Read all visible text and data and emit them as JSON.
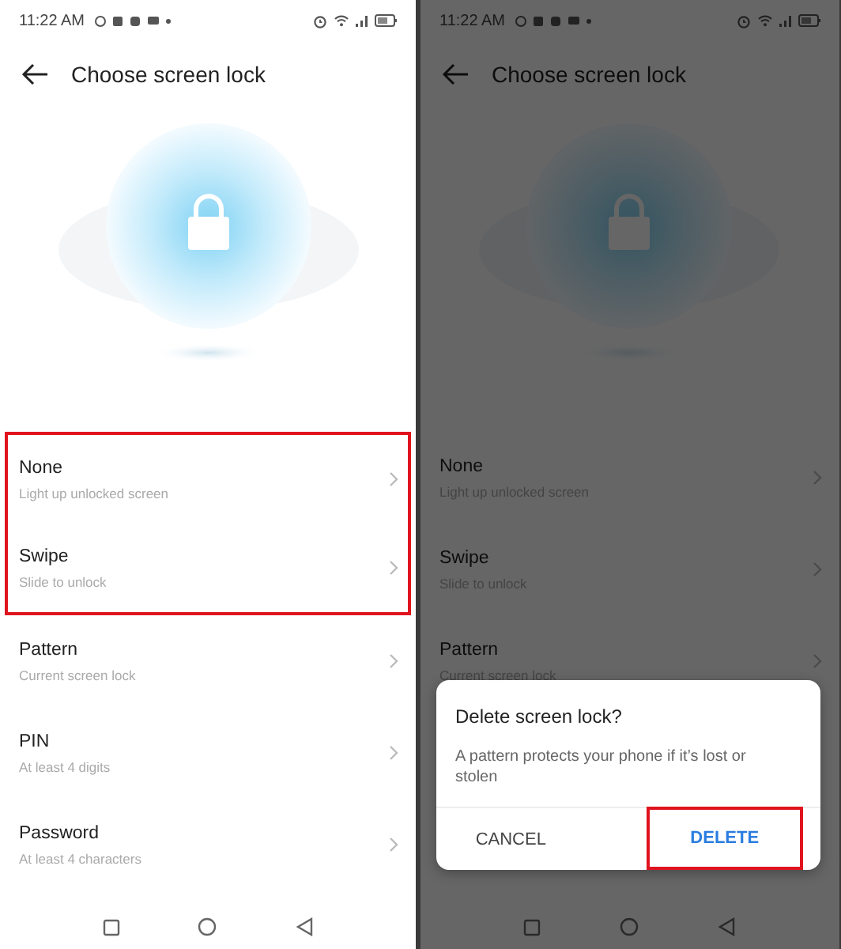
{
  "screens": [
    {
      "status_bar": {
        "time": "11:22 AM"
      },
      "title": "Choose screen lock",
      "dimmed": false,
      "options": [
        {
          "title": "None",
          "subtitle": "Light up unlocked screen",
          "highlighted": true
        },
        {
          "title": "Swipe",
          "subtitle": "Slide to unlock",
          "highlighted": true
        },
        {
          "title": "Pattern",
          "subtitle": "Current screen lock",
          "highlighted": false
        },
        {
          "title": "PIN",
          "subtitle": "At least 4 digits",
          "highlighted": false
        },
        {
          "title": "Password",
          "subtitle": "At least 4 characters",
          "highlighted": false
        }
      ]
    },
    {
      "status_bar": {
        "time": "11:22 AM"
      },
      "title": "Choose screen lock",
      "dimmed": true,
      "options": [
        {
          "title": "None",
          "subtitle": "Light up unlocked screen",
          "highlighted": false
        },
        {
          "title": "Swipe",
          "subtitle": "Slide to unlock",
          "highlighted": false
        },
        {
          "title": "Pattern",
          "subtitle": "Current screen lock",
          "highlighted": false
        }
      ],
      "dialog": {
        "title": "Delete screen lock?",
        "message": "A pattern protects your phone if it’s lost or stolen",
        "buttons": [
          {
            "label": "CANCEL",
            "kind": "neutral",
            "highlighted": false
          },
          {
            "label": "DELETE",
            "kind": "primary",
            "highlighted": true
          }
        ]
      }
    }
  ]
}
